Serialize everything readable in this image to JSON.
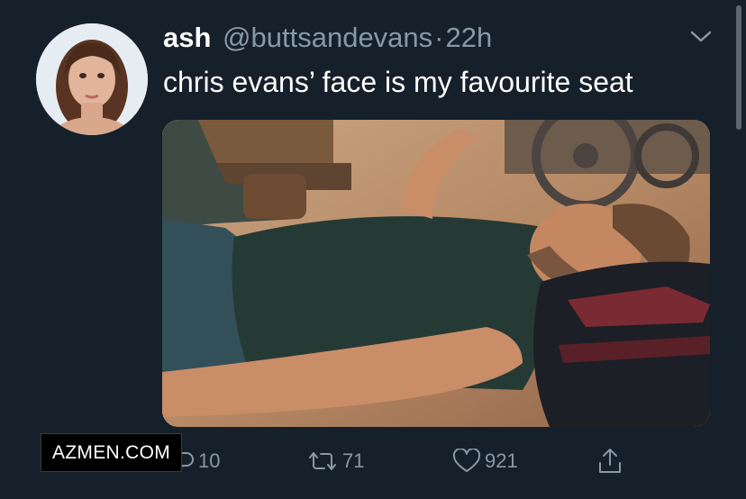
{
  "tweet": {
    "display_name": "ash",
    "handle": "@buttsandevans",
    "separator": "·",
    "time": "22h",
    "text": "chris evans’ face is my favourite seat"
  },
  "actions": {
    "reply_count": "10",
    "retweet_count": "71",
    "like_count": "921"
  },
  "watermark": "AZMEN.COM",
  "icons": {
    "menu": "chevron-down-icon",
    "reply": "reply-icon",
    "retweet": "retweet-icon",
    "like": "heart-icon",
    "share": "share-icon"
  },
  "colors": {
    "background": "#15202b",
    "secondary_text": "#8899a6",
    "primary_text": "#ffffff"
  }
}
